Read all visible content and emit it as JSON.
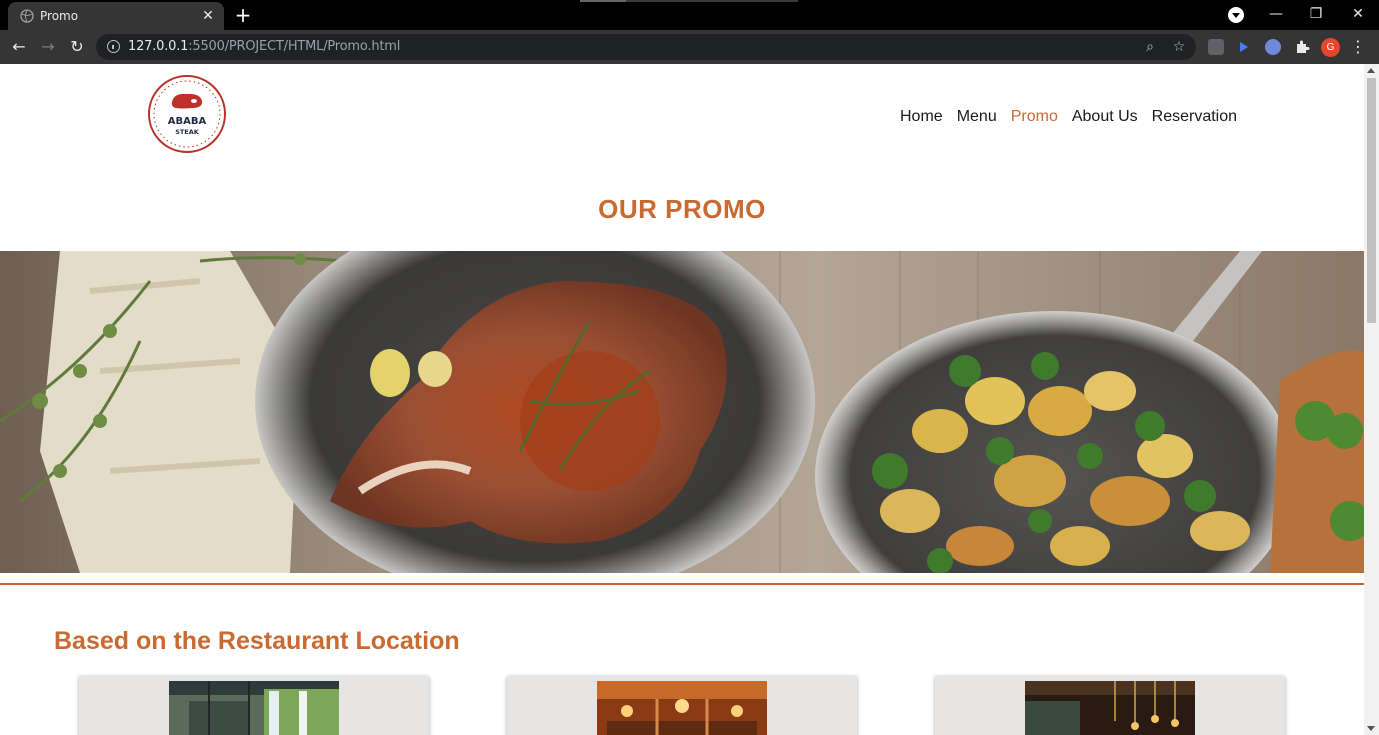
{
  "browser": {
    "tab_title": "Promo",
    "tab_close": "✕",
    "new_tab": "+",
    "url_host": "127.0.0.1",
    "url_rest": ":5500/PROJECT/HTML/Promo.html",
    "avatar_letter": "G",
    "controls": {
      "minimize": "—",
      "restore": "❐",
      "close": "✕"
    }
  },
  "site": {
    "logo_text_top": "ABABA",
    "logo_text_bottom": "STEAK",
    "nav": [
      {
        "label": "Home",
        "active": false
      },
      {
        "label": "Menu",
        "active": false
      },
      {
        "label": "Promo",
        "active": true
      },
      {
        "label": "About Us",
        "active": false
      },
      {
        "label": "Reservation",
        "active": false
      }
    ],
    "page_title": "OUR PROMO",
    "section_heading": "Based on the Restaurant Location",
    "cards": [
      {
        "image": "restaurant-garden-interior"
      },
      {
        "image": "restaurant-warm-dining-room"
      },
      {
        "image": "restaurant-chandelier-interior"
      }
    ]
  },
  "colors": {
    "accent": "#c96a30",
    "browser_dark": "#353535",
    "card_bg": "#e6e5e4"
  }
}
